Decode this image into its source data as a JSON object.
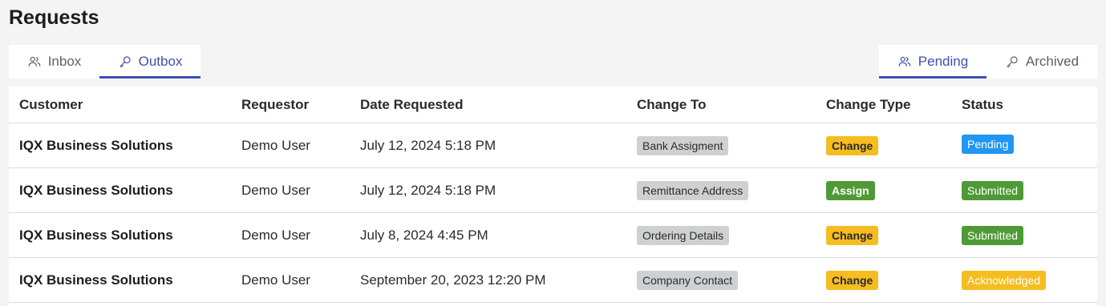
{
  "page": {
    "title": "Requests"
  },
  "tabs_left": [
    {
      "label": "Inbox",
      "icon": "users-icon",
      "active": false
    },
    {
      "label": "Outbox",
      "icon": "key-icon",
      "active": true
    }
  ],
  "tabs_right": [
    {
      "label": "Pending",
      "icon": "users-icon",
      "active": true
    },
    {
      "label": "Archived",
      "icon": "key-icon",
      "active": false
    }
  ],
  "table": {
    "columns": [
      "Customer",
      "Requestor",
      "Date Requested",
      "Change To",
      "Change Type",
      "Status"
    ],
    "rows": [
      {
        "customer": "IQX Business Solutions",
        "requestor": "Demo User",
        "date": "July 12, 2024 5:18 PM",
        "change_to": "Bank Assigment",
        "change_type": "Change",
        "status": "Pending"
      },
      {
        "customer": "IQX Business Solutions",
        "requestor": "Demo User",
        "date": "July 12, 2024 5:18 PM",
        "change_to": "Remittance Address",
        "change_type": "Assign",
        "status": "Submitted"
      },
      {
        "customer": "IQX Business Solutions",
        "requestor": "Demo User",
        "date": "July 8, 2024 4:45 PM",
        "change_to": "Ordering Details",
        "change_type": "Change",
        "status": "Submitted"
      },
      {
        "customer": "IQX Business Solutions",
        "requestor": "Demo User",
        "date": "September 20, 2023 12:20 PM",
        "change_to": "Company Contact",
        "change_type": "Change",
        "status": "Acknowledged"
      }
    ]
  },
  "colors": {
    "accent": "#3e4fb5",
    "change_type_change": "#f6bd21",
    "change_type_assign": "#4f9a36",
    "status_pending": "#2196f3",
    "status_submitted": "#4f9a36",
    "status_acknowledged": "#f6bd21",
    "chip_gray": "#cfd0d2"
  }
}
